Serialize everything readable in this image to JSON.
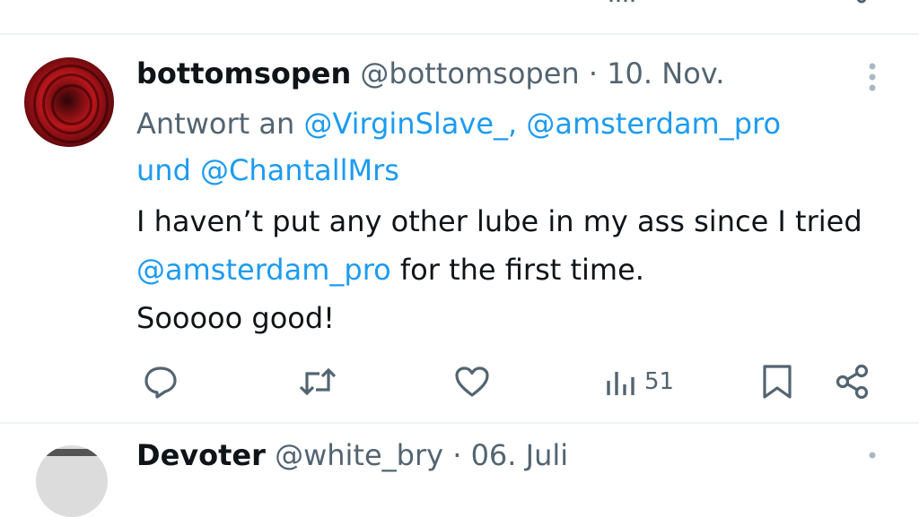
{
  "tweet": {
    "display_name": "bottomsopen",
    "handle": "@bottomsopen",
    "separator": "·",
    "date": "10. Nov.",
    "reply_prefix": "Antwort an",
    "reply_mention_1": "@VirginSlave_,",
    "reply_mention_2": "@amsterdam_pro",
    "reply_connector": "und",
    "reply_mention_3": "@ChantallMrs",
    "text_part1": "I haven’t put any other lube in my ass since I tried",
    "text_mention": "@amsterdam_pro",
    "text_part2": "for the first time.",
    "text_line3": "Sooooo good!",
    "views": "51"
  },
  "next_tweet": {
    "display_name": "Devoter",
    "handle": "@white_bry",
    "separator": "·",
    "date": "06. Juli"
  },
  "colors": {
    "text": "#0f1419",
    "secondary": "#536471",
    "link": "#1d9bf0",
    "divider": "#eff3f4"
  },
  "icons": {
    "reply": "reply-icon",
    "retweet": "retweet-icon",
    "like": "like-icon",
    "views": "views-icon",
    "bookmark": "bookmark-icon",
    "share": "share-icon",
    "more": "more-icon"
  }
}
